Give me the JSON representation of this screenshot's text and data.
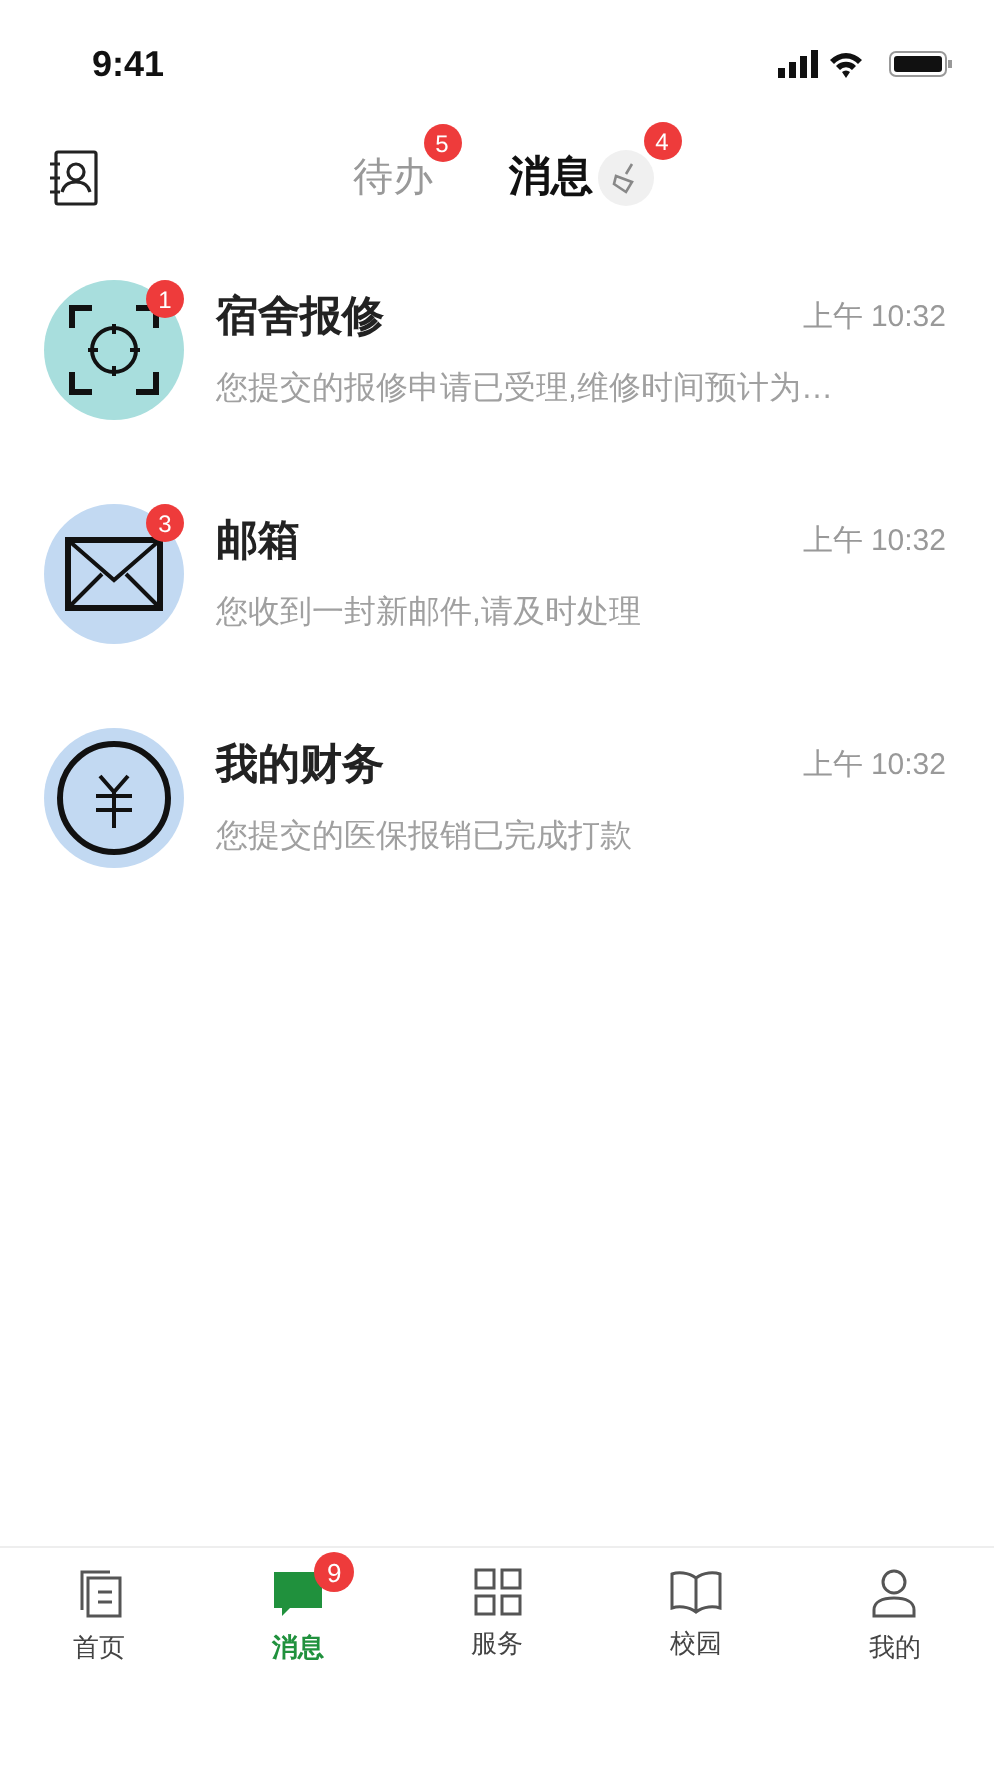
{
  "status_bar": {
    "time": "9:41"
  },
  "header": {
    "tabs": [
      {
        "label": "待办",
        "badge": "5",
        "selected": false
      },
      {
        "label": "消息",
        "badge": "4",
        "selected": true
      }
    ]
  },
  "messages": [
    {
      "kind": "repair",
      "title": "宿舍报修",
      "time": "上午 10:32",
      "preview": "您提交的报修申请已受理,维修时间预计为…",
      "badge": "1",
      "color": "#a8dedd"
    },
    {
      "kind": "mail",
      "title": "邮箱",
      "time": "上午 10:32",
      "preview": "您收到一封新邮件,请及时处理",
      "badge": "3",
      "color": "#c2d9f2"
    },
    {
      "kind": "finance",
      "title": "我的财务",
      "time": "上午 10:32",
      "preview": "您提交的医保报销已完成打款",
      "color": "#c2d9f2"
    }
  ],
  "tab_bar": [
    {
      "kind": "home",
      "label": "首页",
      "selected": false
    },
    {
      "kind": "messages",
      "label": "消息",
      "badge": "9",
      "selected": true
    },
    {
      "kind": "services",
      "label": "服务",
      "selected": false
    },
    {
      "kind": "campus",
      "label": "校园",
      "selected": false
    },
    {
      "kind": "me",
      "label": "我的",
      "selected": false
    }
  ]
}
